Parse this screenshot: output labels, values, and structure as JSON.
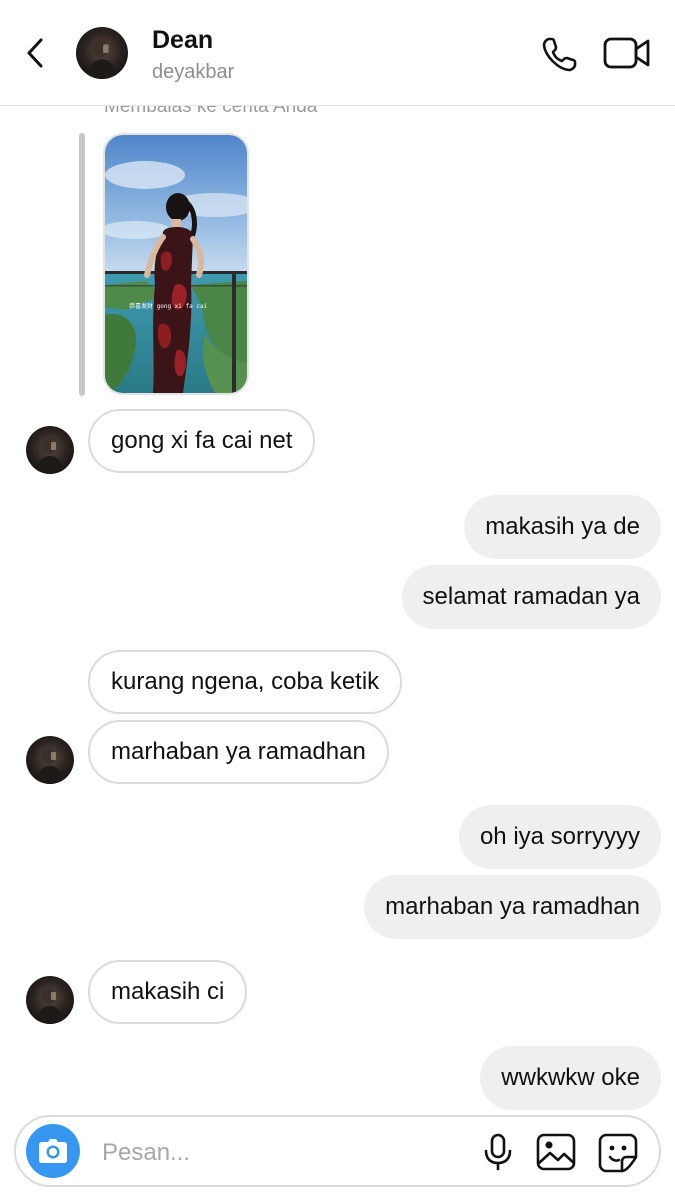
{
  "header": {
    "name": "Dean",
    "username": "deyakbar"
  },
  "story_reply": {
    "caption": "Membalas ke cerita Anda",
    "overlay_text": "恭喜发财 gong xi fa cai"
  },
  "messages": [
    {
      "side": "in",
      "text": "gong xi fa cai net"
    },
    {
      "side": "out",
      "text": "makasih ya de"
    },
    {
      "side": "out",
      "text": "selamat ramadan ya"
    },
    {
      "side": "in",
      "text": "kurang ngena, coba ketik"
    },
    {
      "side": "in",
      "text": "marhaban ya ramadhan"
    },
    {
      "side": "out",
      "text": "oh iya sorryyyy"
    },
    {
      "side": "out",
      "text": "marhaban ya ramadhan"
    },
    {
      "side": "in",
      "text": "makasih ci"
    },
    {
      "side": "out",
      "text": "wwkwkw oke"
    }
  ],
  "composer": {
    "placeholder": "Pesan..."
  },
  "icons": {
    "back": "chevron-left-icon",
    "call": "phone-icon",
    "video": "video-camera-icon",
    "camera": "camera-icon",
    "mic": "microphone-icon",
    "gallery": "image-icon",
    "sticker": "sticker-icon"
  },
  "colors": {
    "accent": "#3797f0",
    "incoming_bubble_border": "#dbdbdb",
    "outgoing_bubble": "#efefef",
    "secondary_text": "#8e8e8e"
  }
}
